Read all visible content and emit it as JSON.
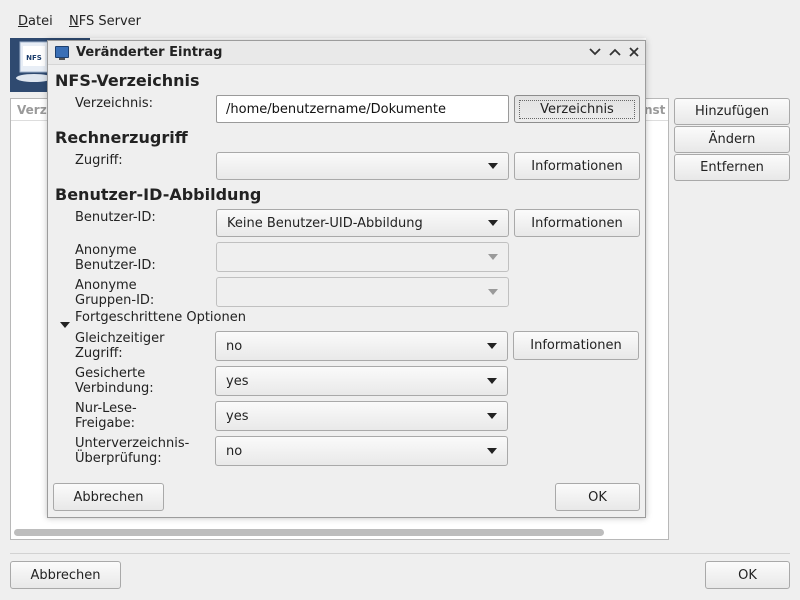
{
  "menubar": {
    "items": [
      {
        "accel": "D",
        "rest": "atei"
      },
      {
        "accel": "N",
        "rest": "FS Server"
      }
    ]
  },
  "background": {
    "logo_text": "NFS",
    "list_header_left": "Verz",
    "list_header_right": "nst",
    "side_buttons": {
      "add": "Hinzufügen",
      "change": "Ändern",
      "remove": "Entfernen"
    },
    "cancel": "Abbrechen",
    "ok": "OK"
  },
  "dialog": {
    "title": "Veränderter Eintrag",
    "sections": {
      "nfs_dir": "NFS-Verzeichnis",
      "host_access": "Rechnerzugriff",
      "user_id_mapping": "Benutzer-ID-Abbildung"
    },
    "directory": {
      "label": "Verzeichnis:",
      "value": "/home/benutzername/Dokumente",
      "button": "Verzeichnis"
    },
    "access": {
      "label": "Zugriff:",
      "value": "",
      "info": "Informationen"
    },
    "user_id": {
      "label": "Benutzer-ID:",
      "value": "Keine Benutzer-UID-Abbildung",
      "info": "Informationen"
    },
    "anon_user": {
      "label1": "Anonyme",
      "label2": "Benutzer-ID:",
      "value": ""
    },
    "anon_group": {
      "label1": "Anonyme",
      "label2": "Gruppen-ID:",
      "value": ""
    },
    "advanced": {
      "label": "Fortgeschrittene Optionen"
    },
    "concurrent": {
      "label1": "Gleichzeitiger",
      "label2": "Zugriff:",
      "value": "no",
      "info": "Informationen"
    },
    "secure": {
      "label1": "Gesicherte",
      "label2": "Verbindung:",
      "value": "yes"
    },
    "readonly": {
      "label1": "Nur-Lese-",
      "label2": "Freigabe:",
      "value": "yes"
    },
    "subtree": {
      "label1": "Unterverzeichnis-",
      "label2": "Überprüfung:",
      "value": "no"
    },
    "cancel": "Abbrechen",
    "ok": "OK"
  }
}
